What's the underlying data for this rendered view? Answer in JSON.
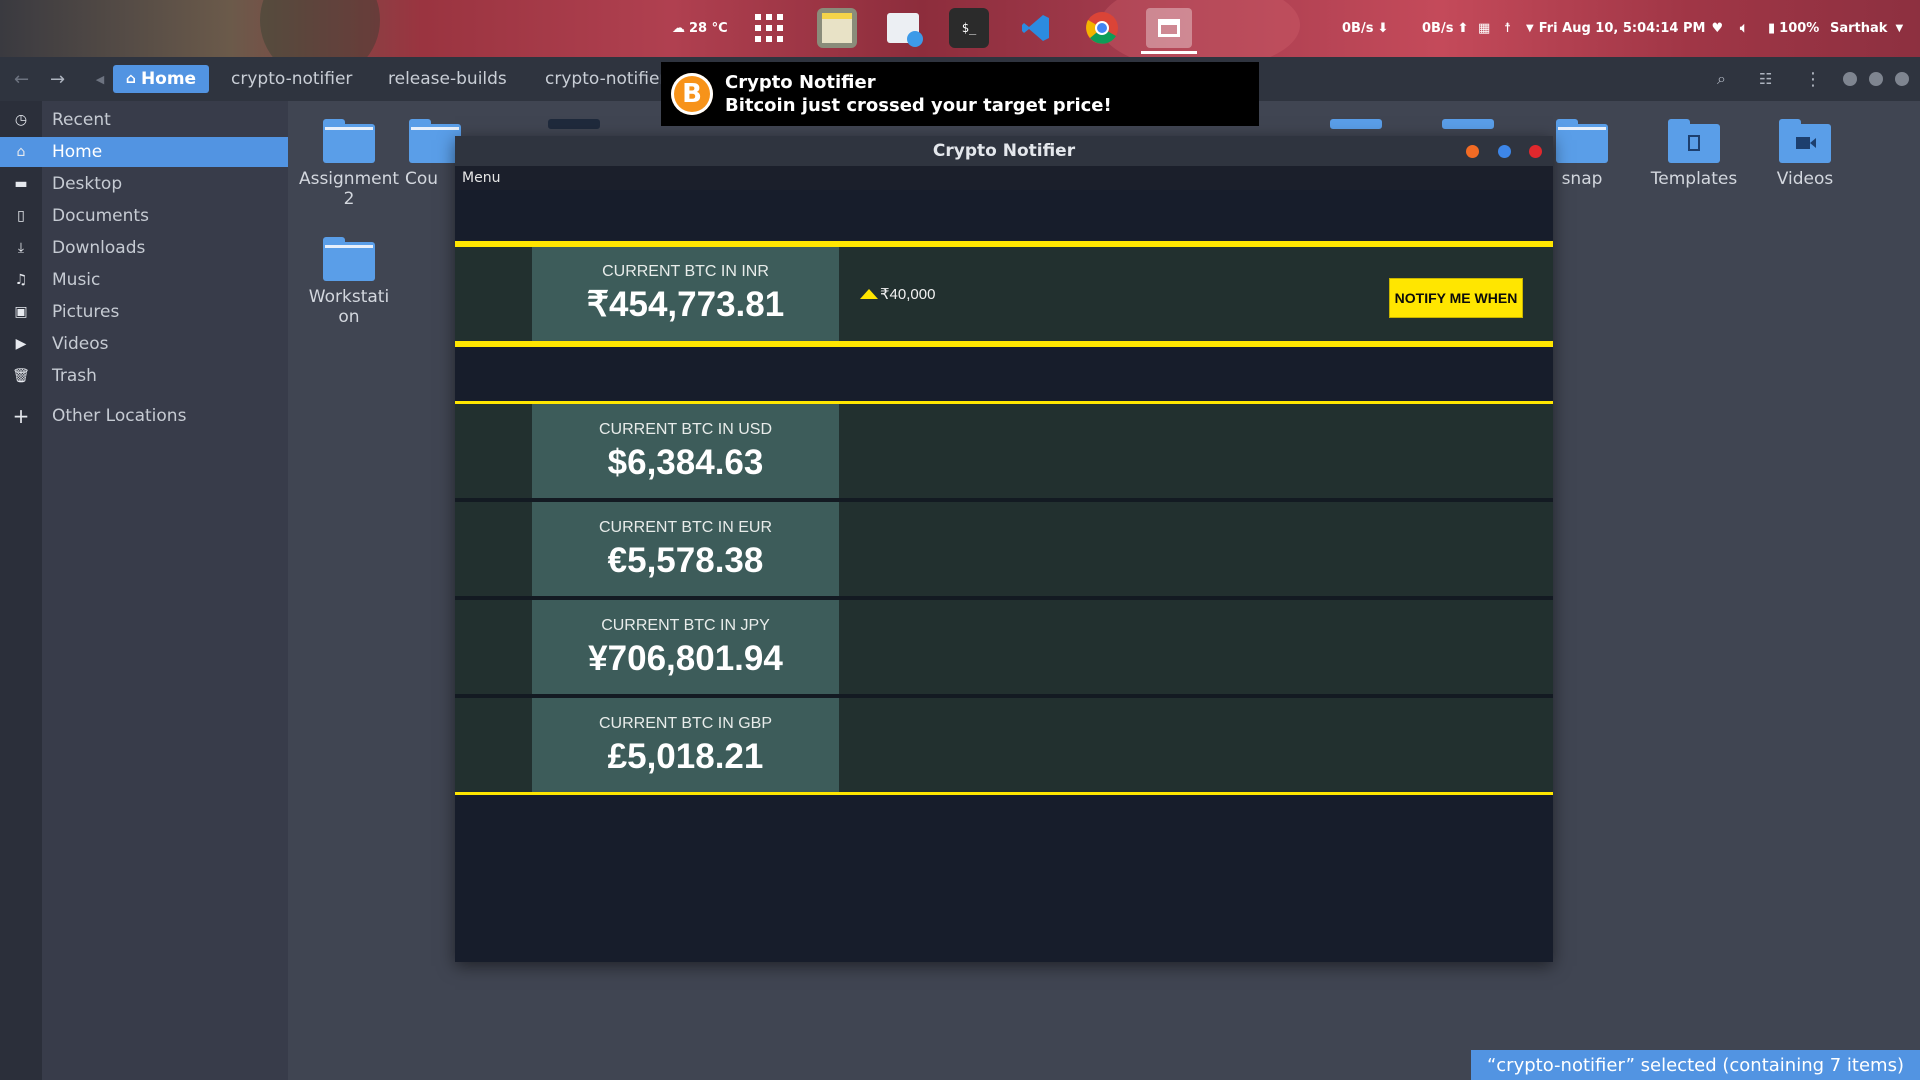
{
  "topbar": {
    "weather": "28 °C",
    "net_down": "0B/s",
    "net_up": "0B/s",
    "datetime": "Fri Aug 10,  5:04:14 PM",
    "battery": "100%",
    "user": "Sarthak"
  },
  "dock": [
    "apps-grid-icon",
    "files-icon",
    "store-icon",
    "terminal-icon",
    "vscode-icon",
    "chrome-icon",
    "window-icon"
  ],
  "nav": {
    "crumbs": [
      "Home",
      "crypto-notifier",
      "release-builds",
      "crypto-notifier"
    ]
  },
  "sidebar": {
    "items": [
      {
        "label": "Recent",
        "icon": "clock-icon"
      },
      {
        "label": "Home",
        "icon": "home-icon"
      },
      {
        "label": "Desktop",
        "icon": "desktop-icon"
      },
      {
        "label": "Documents",
        "icon": "document-icon"
      },
      {
        "label": "Downloads",
        "icon": "download-icon"
      },
      {
        "label": "Music",
        "icon": "music-icon"
      },
      {
        "label": "Pictures",
        "icon": "picture-icon"
      },
      {
        "label": "Videos",
        "icon": "video-icon"
      },
      {
        "label": "Trash",
        "icon": "trash-icon"
      },
      {
        "label": "Other Locations",
        "icon": "plus-icon"
      }
    ]
  },
  "folders": {
    "assignment": "Assignment 2",
    "cou": "Cou",
    "workstation": "Workstation",
    "snap": "snap",
    "templates": "Templates",
    "videos": "Videos"
  },
  "status": "“crypto-notifier” selected (containing 7 items)",
  "notification": {
    "title": "Crypto Notifier",
    "body": "Bitcoin just crossed your target price!",
    "icon_letter": "B"
  },
  "app": {
    "title": "Crypto Notifier",
    "menu": "Menu",
    "inr": {
      "caption": "CURRENT BTC IN INR",
      "value": "₹454,773.81"
    },
    "target": "₹40,000",
    "notify_button": "NOTIFY ME WHEN",
    "usd": {
      "caption": "CURRENT BTC IN USD",
      "value": "$6,384.63"
    },
    "eur": {
      "caption": "CURRENT BTC IN EUR",
      "value": "€5,578.38"
    },
    "jpy": {
      "caption": "CURRENT BTC IN JPY",
      "value": "¥706,801.94"
    },
    "gbp": {
      "caption": "CURRENT BTC IN GBP",
      "value": "£5,018.21"
    }
  },
  "colors": {
    "accent": "#5294e2",
    "yellow": "#ffe600",
    "bitcoin": "#f7931a"
  }
}
